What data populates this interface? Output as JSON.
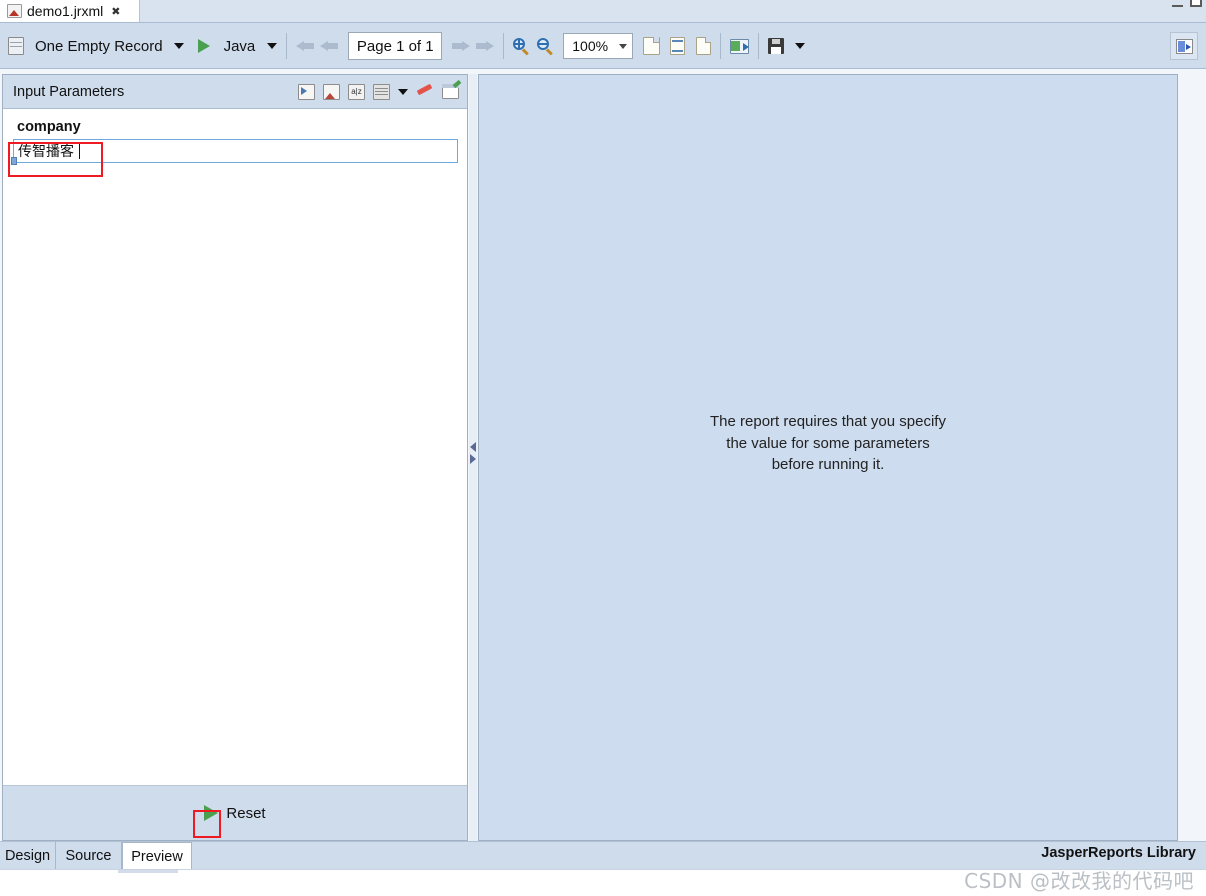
{
  "window": {
    "minimize_label": "minimize",
    "maximize_label": "maximize"
  },
  "editor_tab": {
    "filename": "demo1.jrxml",
    "close_glyph": "✖",
    "icon": "jrxml-file-icon"
  },
  "toolbar": {
    "datasource_label": "One Empty Record",
    "datasource_icon": "datasource-icon",
    "datasource_caret": "▼",
    "run_icon": "run-play-icon",
    "language_label": "Java",
    "language_caret": "▼",
    "nav_first_icon": "first-page-icon",
    "nav_prev_icon": "previous-page-icon",
    "page_indicator": "Page 1 of 1",
    "nav_next_icon": "next-page-icon",
    "nav_last_icon": "last-page-icon",
    "zoom_in_icon": "zoom-in-icon",
    "zoom_out_icon": "zoom-out-icon",
    "zoom_value": "100%",
    "zoom_caret": "⌄",
    "fit_page_icon": "fit-page-icon",
    "fit_width_icon": "fit-width-icon",
    "actual_size_icon": "actual-size-icon",
    "export_icon": "export-icon",
    "save_icon": "save-icon",
    "save_caret": "▼",
    "right_panel_icon": "toggle-panel-icon"
  },
  "parameters_panel": {
    "title": "Input Parameters",
    "icons": [
      "save-parameters-icon",
      "load-parameters-icon",
      "sort-az-icon",
      "parameters-table-icon",
      "parameters-menu-caret",
      "clear-parameters-icon",
      "edit-dialog-icon"
    ],
    "caret_glyph": "▼",
    "parameters": [
      {
        "name": "company",
        "value": "传智播客",
        "placeholder": ""
      }
    ],
    "reset_button": {
      "label": "Reset",
      "icon": "reset-play-icon"
    },
    "highlight_color": "#ee1c22"
  },
  "splitter": {
    "collapse_left_icon": "collapse-left-arrow",
    "collapse_right_icon": "collapse-right-arrow"
  },
  "preview": {
    "message_line1": "The report requires that you specify",
    "message_line2": "the value for some parameters",
    "message_line3": "before running it.",
    "background_color": "#cddcee"
  },
  "bottom": {
    "tabs": [
      {
        "label": "Design",
        "active": false
      },
      {
        "label": "Source",
        "active": false
      },
      {
        "label": "Preview",
        "active": true
      }
    ],
    "status_right": "JasperReports Library"
  },
  "watermark": {
    "text": "CSDN @改改我的代码吧"
  }
}
